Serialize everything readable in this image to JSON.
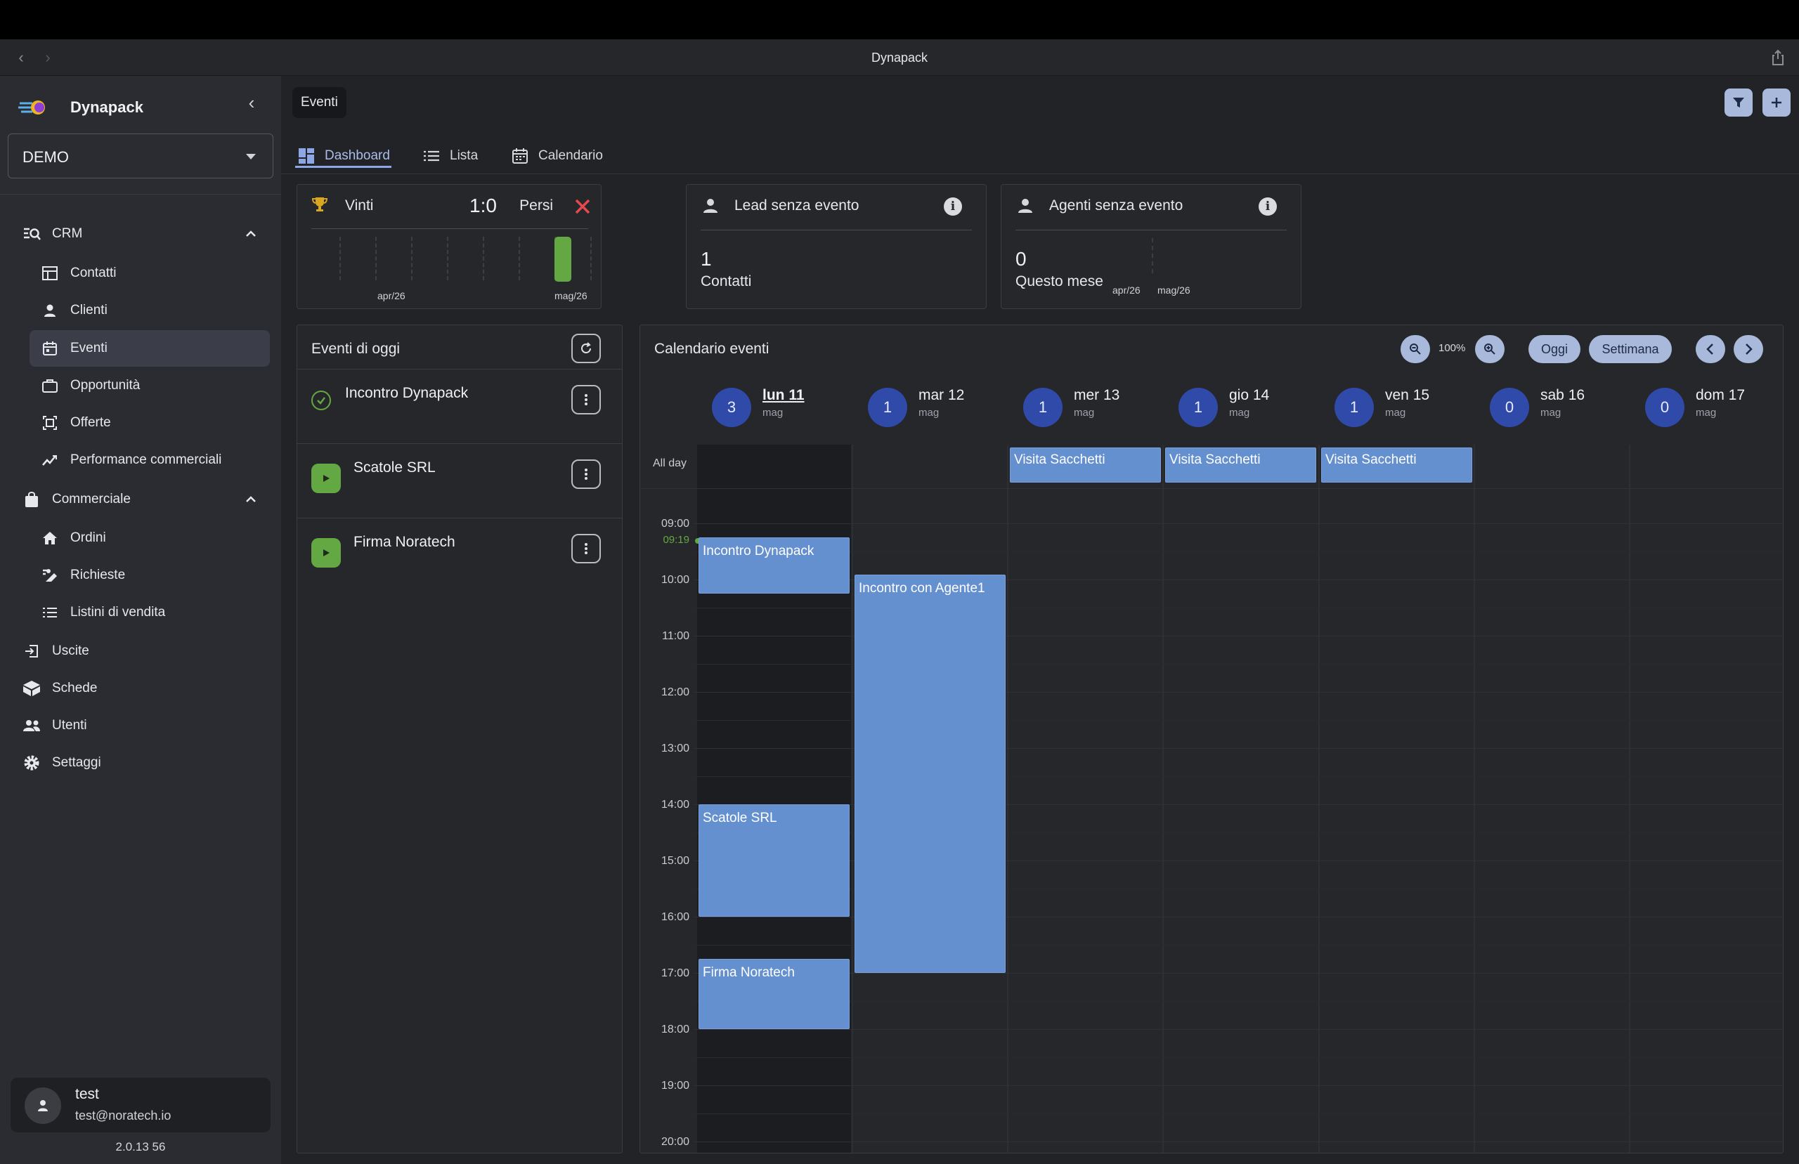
{
  "window": {
    "title": "Dynapack"
  },
  "sidebar": {
    "brand": "Dynapack",
    "org_select": "DEMO",
    "items": [
      {
        "label": "CRM",
        "icon": "crm-search-icon"
      },
      {
        "label": "Contatti",
        "icon": "table-icon"
      },
      {
        "label": "Clienti",
        "icon": "person-icon"
      },
      {
        "label": "Eventi",
        "icon": "calendar-icon"
      },
      {
        "label": "Opportunità",
        "icon": "briefcase-icon"
      },
      {
        "label": "Offerte",
        "icon": "offer-icon"
      },
      {
        "label": "Performance commerciali",
        "icon": "chart-line-icon"
      },
      {
        "label": "Commerciale",
        "icon": "bag-icon"
      },
      {
        "label": "Ordini",
        "icon": "home-icon"
      },
      {
        "label": "Richieste",
        "icon": "request-icon"
      },
      {
        "label": "Listini di vendita",
        "icon": "list-icon"
      },
      {
        "label": "Uscite",
        "icon": "exit-icon"
      },
      {
        "label": "Schede",
        "icon": "box-icon"
      },
      {
        "label": "Utenti",
        "icon": "users-icon"
      },
      {
        "label": "Settaggi",
        "icon": "gear-icon"
      }
    ],
    "user": {
      "name": "test",
      "email": "test@noratech.io"
    },
    "version": "2.0.13 56"
  },
  "page": {
    "title": "Eventi",
    "tabs": [
      "Dashboard",
      "Lista",
      "Calendario"
    ]
  },
  "kpi": {
    "won_lost": {
      "won_label": "Vinti",
      "score": "1:0",
      "lost_label": "Persi",
      "x_labels": [
        "apr/26",
        "mag/26"
      ]
    },
    "lead": {
      "title": "Lead senza evento",
      "value": "1",
      "sub": "Contatti"
    },
    "agents": {
      "title": "Agenti senza evento",
      "value": "0",
      "sub": "Questo mese",
      "x_labels": [
        "apr/26",
        "mag/26"
      ]
    }
  },
  "today": {
    "title": "Eventi di oggi",
    "events": [
      {
        "name": "Incontro Dynapack",
        "status": "done"
      },
      {
        "name": "Scatole SRL",
        "status": "todo"
      },
      {
        "name": "Firma Noratech",
        "status": "todo"
      }
    ]
  },
  "calendar": {
    "title": "Calendario eventi",
    "zoom": "100%",
    "today_btn": "Oggi",
    "view_btn": "Settimana",
    "allday_label": "All day",
    "now_label": "09:19",
    "days": [
      {
        "count": "3",
        "name": "lun 11",
        "month": "mag"
      },
      {
        "count": "1",
        "name": "mar 12",
        "month": "mag"
      },
      {
        "count": "1",
        "name": "mer 13",
        "month": "mag"
      },
      {
        "count": "1",
        "name": "gio 14",
        "month": "mag"
      },
      {
        "count": "1",
        "name": "ven 15",
        "month": "mag"
      },
      {
        "count": "0",
        "name": "sab 16",
        "month": "mag"
      },
      {
        "count": "0",
        "name": "dom 17",
        "month": "mag"
      }
    ],
    "hours": [
      "09:00",
      "10:00",
      "11:00",
      "12:00",
      "13:00",
      "14:00",
      "15:00",
      "16:00",
      "17:00",
      "18:00",
      "19:00",
      "20:00"
    ],
    "events": [
      {
        "title": "Visita Sacchetti",
        "day": "mer 13",
        "all_day": true
      },
      {
        "title": "Visita Sacchetti",
        "day": "gio 14",
        "all_day": true
      },
      {
        "title": "Visita Sacchetti",
        "day": "ven 15",
        "all_day": true
      },
      {
        "title": "Incontro Dynapack",
        "day": "lun 11",
        "start": "09:15",
        "end": "10:15"
      },
      {
        "title": "Incontro con Agente1",
        "day": "mar 12",
        "start": "09:55",
        "end": "17:00"
      },
      {
        "title": "Scatole SRL",
        "day": "lun 11",
        "start": "14:00",
        "end": "16:00"
      },
      {
        "title": "Firma Noratech",
        "day": "lun 11",
        "start": "16:45",
        "end": "18:00"
      }
    ]
  },
  "colors": {
    "accent": "#8ca6e6",
    "event": "#6590d0",
    "badge": "#2f4aa8",
    "success": "#63a842",
    "danger": "#e5484d"
  }
}
